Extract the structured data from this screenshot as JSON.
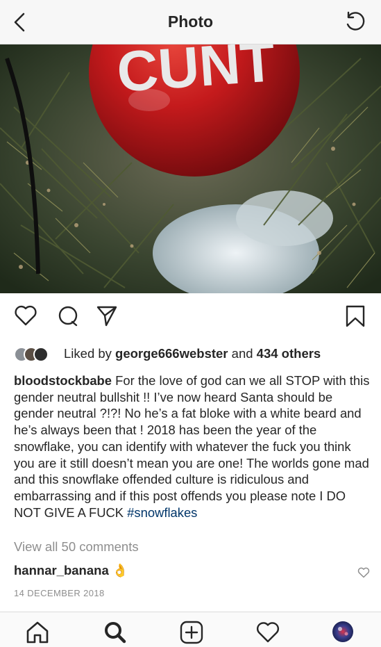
{
  "header": {
    "title": "Photo"
  },
  "photo": {
    "ornament_text": "CUNT",
    "colors": {
      "ornament": "#c8191c",
      "needles": "#2f3a22"
    }
  },
  "likes": {
    "prefix": "Liked by ",
    "user": "george666webster",
    "middle": " and ",
    "others": "434 others"
  },
  "post": {
    "username": "bloodstockbabe",
    "caption": " For the love of god can we all STOP with this gender neutral bullshit !! I’ve now heard Santa should be gender neutral ?!?! No he’s a fat bloke with a white beard and he’s always been that ! 2018 has been the year of the snowflake, you can identify with whatever the fuck you think you are it still doesn’t mean you are one! The worlds gone mad and this snowflake offended culture is ridiculous and embarrassing and if this post offends you please note I DO NOT GIVE A FUCK ",
    "hashtag": "#snowflakes",
    "view_all": "View all 50 comments",
    "date": "14 DECEMBER 2018"
  },
  "comment": {
    "username": "hannar_banana",
    "emoji": "👌"
  },
  "tabbar": {
    "icons": [
      "home-icon",
      "search-icon",
      "add-icon",
      "heart-icon",
      "profile-avatar"
    ]
  }
}
